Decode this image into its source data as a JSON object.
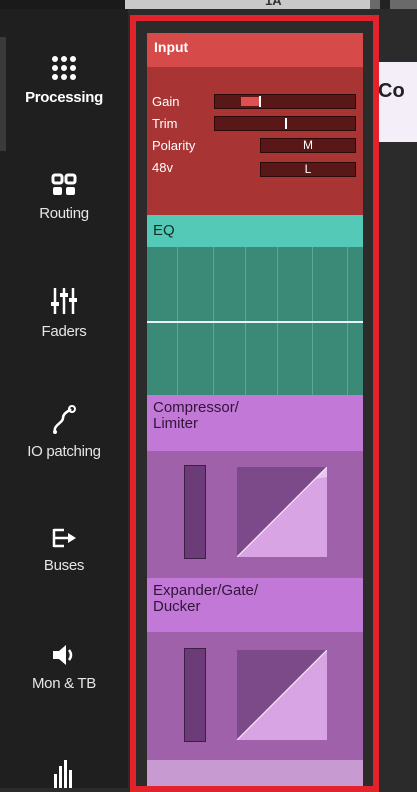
{
  "top": {
    "tab_label": "1A"
  },
  "sidebar": {
    "items": [
      {
        "label": "Processing",
        "icon": "grid-dots-icon"
      },
      {
        "label": "Routing",
        "icon": "routing-icon"
      },
      {
        "label": "Faders",
        "icon": "faders-icon"
      },
      {
        "label": "IO patching",
        "icon": "patch-cable-icon"
      },
      {
        "label": "Buses",
        "icon": "bus-icon"
      },
      {
        "label": "Mon & TB",
        "icon": "speaker-icon"
      },
      {
        "label": "",
        "icon": "meter-icon"
      }
    ]
  },
  "strip": {
    "input": {
      "title": "Input",
      "gain_label": "Gain",
      "trim_label": "Trim",
      "polarity_label": "Polarity",
      "polarity_value": "M",
      "phantom_label": "48v",
      "phantom_value": "L"
    },
    "eq": {
      "title": "EQ"
    },
    "compressor": {
      "title_line1": "Compressor/",
      "title_line2": "Limiter"
    },
    "expander": {
      "title_line1": "Expander/Gate/",
      "title_line2": "Ducker"
    }
  },
  "right_panel": {
    "text": "Co"
  },
  "colors": {
    "input": "#d64a4a",
    "eq": "#55c9b7",
    "dynamics": "#c178d6",
    "selection": "#e3232b"
  }
}
